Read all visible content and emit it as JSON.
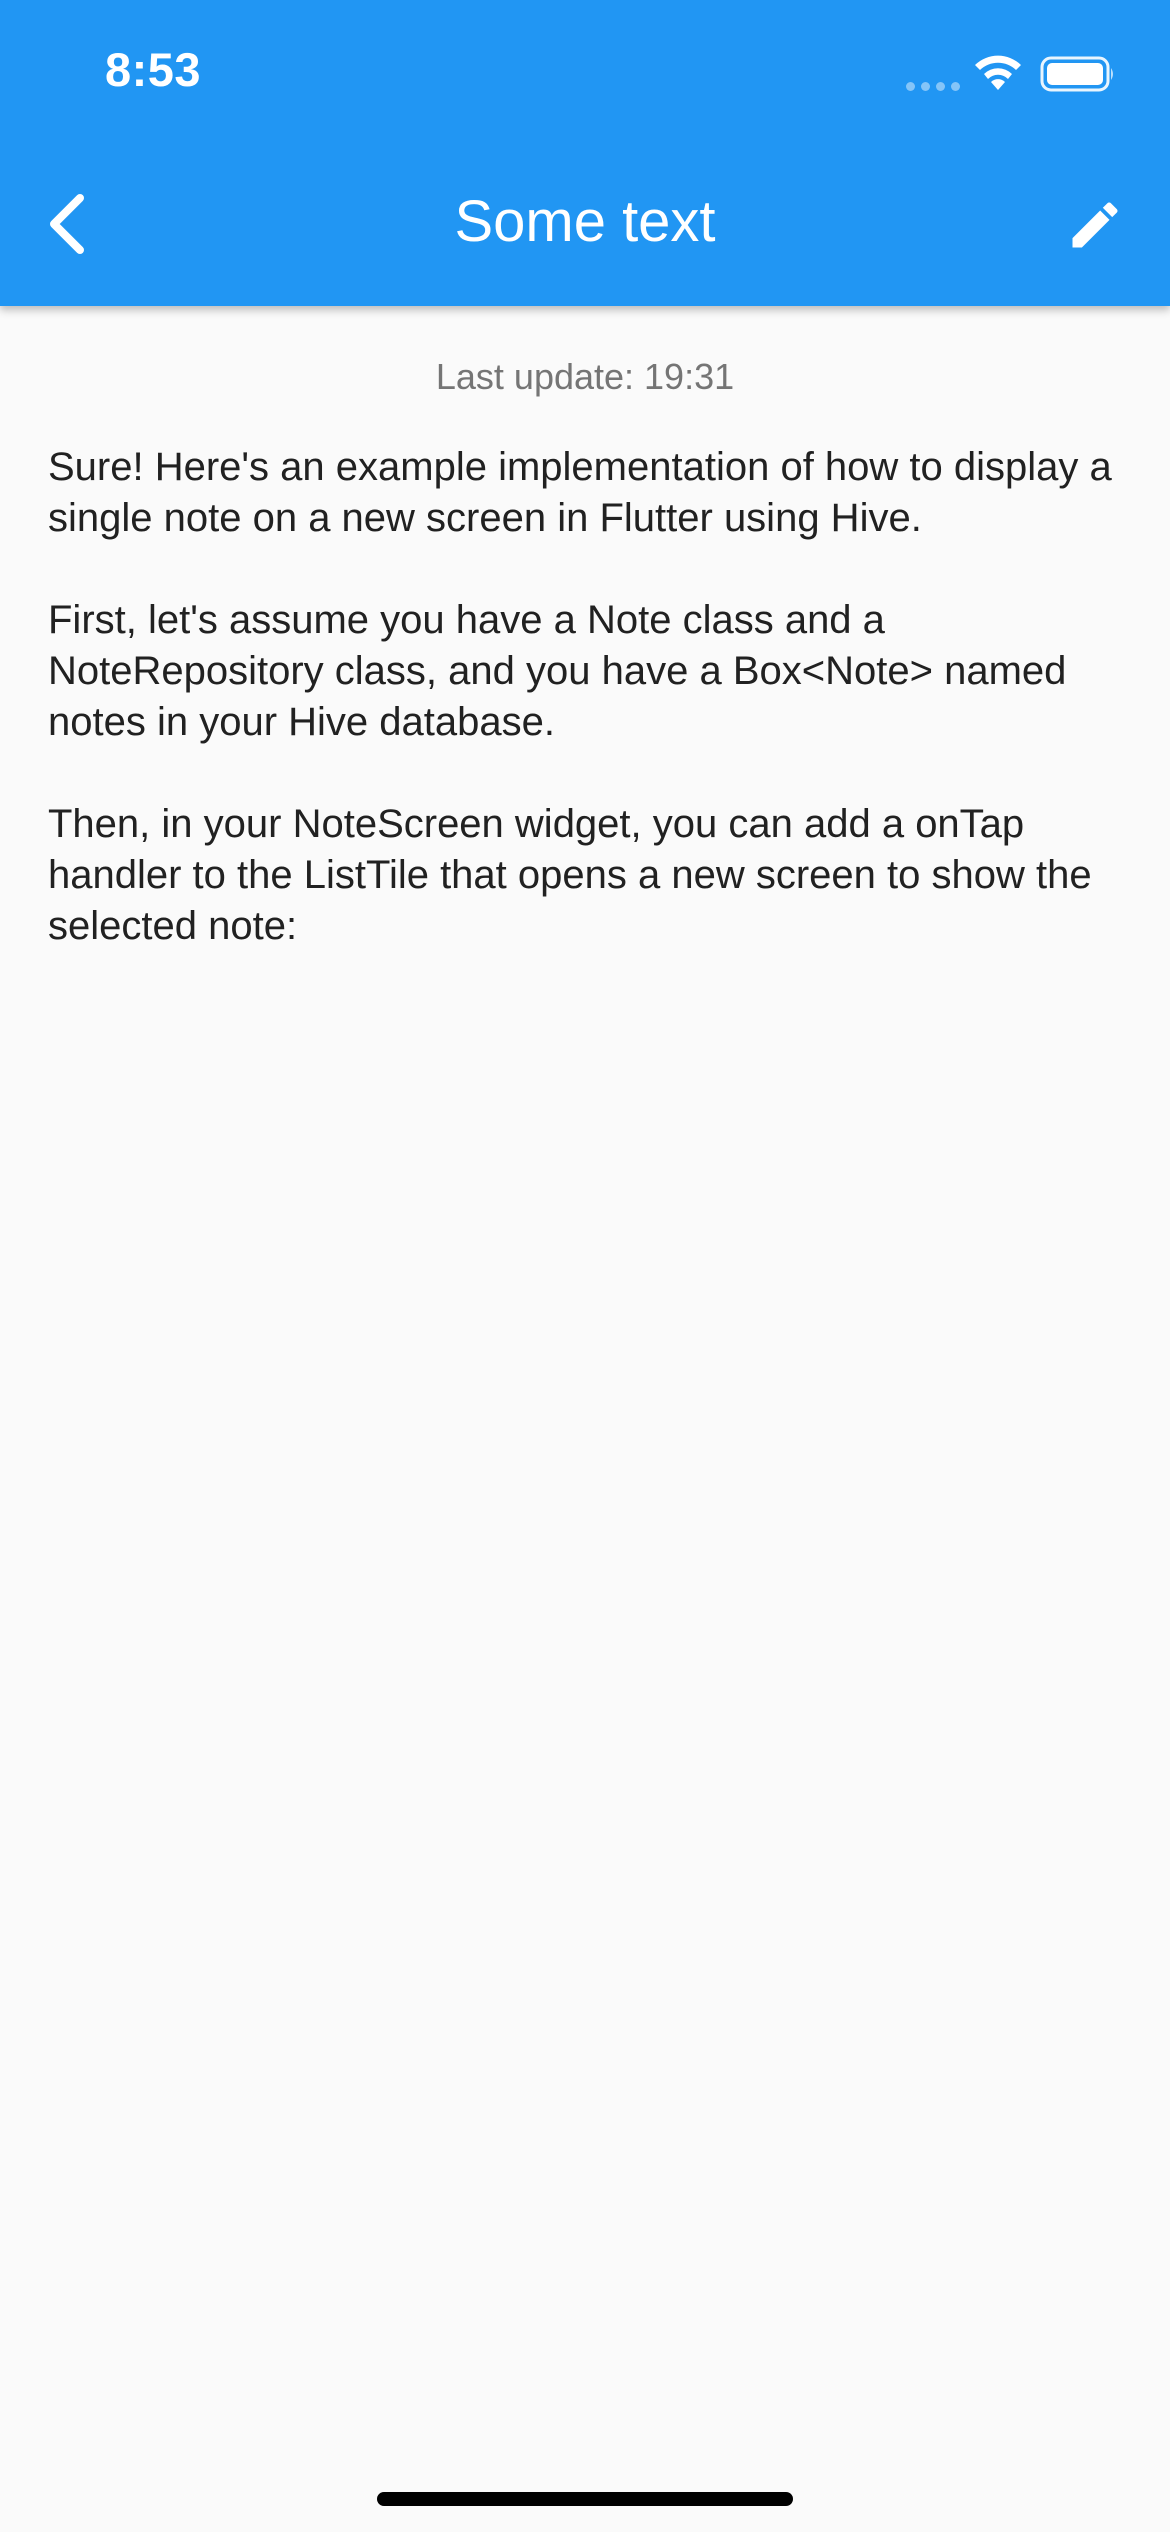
{
  "status_bar": {
    "time": "8:53",
    "icons": [
      "signal-icon",
      "wifi-icon",
      "battery-icon"
    ]
  },
  "app_bar": {
    "title": "Some text",
    "back_icon": "chevron-left-icon",
    "edit_icon": "pencil-icon",
    "background_color": "#2196f3"
  },
  "note": {
    "last_update": "Last update: 19:31",
    "paragraphs": [
      "Sure! Here's an example implementation of how to display a single note on a new screen in Flutter using Hive.",
      "First, let's assume you have a Note class and a NoteRepository class, and you have a Box<Note> named notes in your Hive database.",
      "Then, in your NoteScreen widget, you can add a onTap handler to the ListTile that opens a new screen to show the selected note:"
    ]
  }
}
